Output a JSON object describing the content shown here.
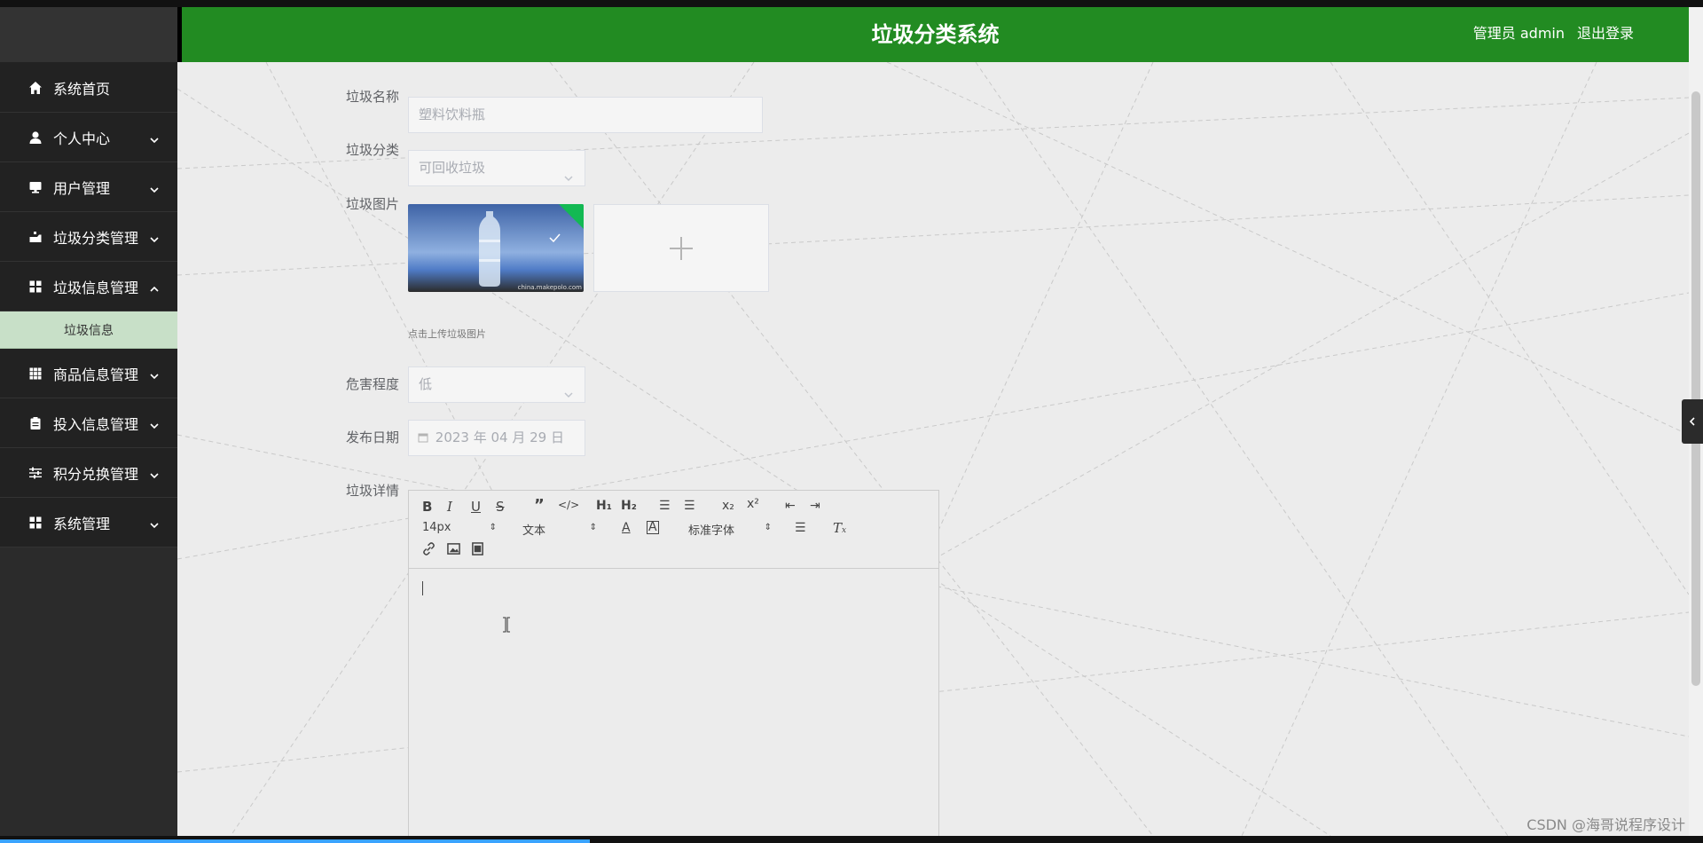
{
  "app": {
    "title": "垃圾分类系统",
    "user_label": "管理员 admin",
    "logout_label": "退出登录"
  },
  "sidebar": {
    "items": [
      {
        "label": "系统首页",
        "icon": "home-icon",
        "has_children": false
      },
      {
        "label": "个人中心",
        "icon": "user-icon",
        "has_children": true
      },
      {
        "label": "用户管理",
        "icon": "monitor-icon",
        "has_children": true
      },
      {
        "label": "垃圾分类管理",
        "icon": "recycle-icon",
        "has_children": true
      },
      {
        "label": "垃圾信息管理",
        "icon": "grid-icon",
        "has_children": true,
        "expanded": true
      },
      {
        "label": "商品信息管理",
        "icon": "table-icon",
        "has_children": true
      },
      {
        "label": "投入信息管理",
        "icon": "clipboard-icon",
        "has_children": true
      },
      {
        "label": "积分兑换管理",
        "icon": "sliders-icon",
        "has_children": true
      },
      {
        "label": "系统管理",
        "icon": "grid-icon",
        "has_children": true
      }
    ],
    "sub_item": "垃圾信息"
  },
  "form": {
    "name_label": "垃圾名称",
    "name_value": "塑料饮料瓶",
    "category_label": "垃圾分类",
    "category_value": "可回收垃圾",
    "image_label": "垃圾图片",
    "image_caption": "china.makepolo.com",
    "upload_tip": "点击上传垃圾图片",
    "hazard_label": "危害程度",
    "hazard_value": "低",
    "date_label": "发布日期",
    "date_value": "2023 年 04 月 29 日",
    "detail_label": "垃圾详情"
  },
  "editor": {
    "font_size": "14px",
    "header_picker": "文本",
    "font_family": "标准字体",
    "tools": [
      "bold-icon",
      "italic-icon",
      "underline-icon",
      "strike-icon",
      "blockquote-icon",
      "code-block-icon",
      "h1-icon",
      "h2-icon",
      "ordered-list-icon",
      "bullet-list-icon",
      "subscript-icon",
      "superscript-icon",
      "outdent-icon",
      "indent-icon",
      "font-color-icon",
      "background-color-icon",
      "align-icon",
      "clean-icon",
      "link-icon",
      "image-icon",
      "video-icon"
    ]
  },
  "watermark": "CSDN @海哥说程序设计"
}
